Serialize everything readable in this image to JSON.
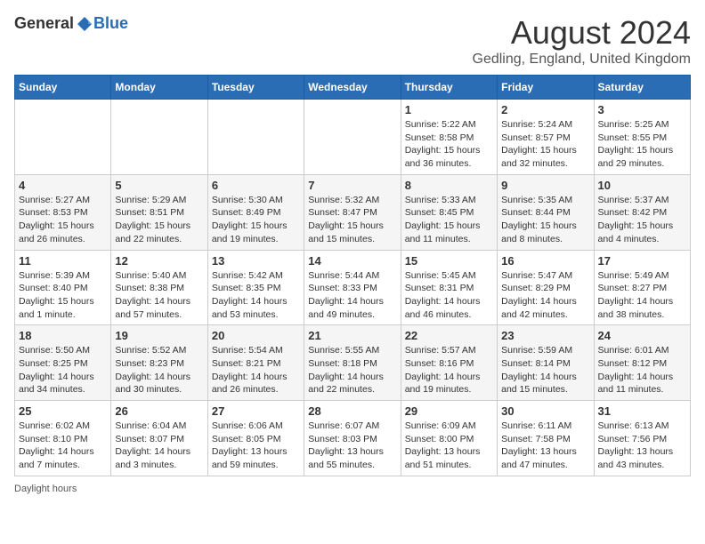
{
  "header": {
    "logo_general": "General",
    "logo_blue": "Blue",
    "main_title": "August 2024",
    "subtitle": "Gedling, England, United Kingdom"
  },
  "calendar": {
    "days_of_week": [
      "Sunday",
      "Monday",
      "Tuesday",
      "Wednesday",
      "Thursday",
      "Friday",
      "Saturday"
    ],
    "weeks": [
      [
        {
          "day": "",
          "info": ""
        },
        {
          "day": "",
          "info": ""
        },
        {
          "day": "",
          "info": ""
        },
        {
          "day": "",
          "info": ""
        },
        {
          "day": "1",
          "info": "Sunrise: 5:22 AM\nSunset: 8:58 PM\nDaylight: 15 hours and 36 minutes."
        },
        {
          "day": "2",
          "info": "Sunrise: 5:24 AM\nSunset: 8:57 PM\nDaylight: 15 hours and 32 minutes."
        },
        {
          "day": "3",
          "info": "Sunrise: 5:25 AM\nSunset: 8:55 PM\nDaylight: 15 hours and 29 minutes."
        }
      ],
      [
        {
          "day": "4",
          "info": "Sunrise: 5:27 AM\nSunset: 8:53 PM\nDaylight: 15 hours and 26 minutes."
        },
        {
          "day": "5",
          "info": "Sunrise: 5:29 AM\nSunset: 8:51 PM\nDaylight: 15 hours and 22 minutes."
        },
        {
          "day": "6",
          "info": "Sunrise: 5:30 AM\nSunset: 8:49 PM\nDaylight: 15 hours and 19 minutes."
        },
        {
          "day": "7",
          "info": "Sunrise: 5:32 AM\nSunset: 8:47 PM\nDaylight: 15 hours and 15 minutes."
        },
        {
          "day": "8",
          "info": "Sunrise: 5:33 AM\nSunset: 8:45 PM\nDaylight: 15 hours and 11 minutes."
        },
        {
          "day": "9",
          "info": "Sunrise: 5:35 AM\nSunset: 8:44 PM\nDaylight: 15 hours and 8 minutes."
        },
        {
          "day": "10",
          "info": "Sunrise: 5:37 AM\nSunset: 8:42 PM\nDaylight: 15 hours and 4 minutes."
        }
      ],
      [
        {
          "day": "11",
          "info": "Sunrise: 5:39 AM\nSunset: 8:40 PM\nDaylight: 15 hours and 1 minute."
        },
        {
          "day": "12",
          "info": "Sunrise: 5:40 AM\nSunset: 8:38 PM\nDaylight: 14 hours and 57 minutes."
        },
        {
          "day": "13",
          "info": "Sunrise: 5:42 AM\nSunset: 8:35 PM\nDaylight: 14 hours and 53 minutes."
        },
        {
          "day": "14",
          "info": "Sunrise: 5:44 AM\nSunset: 8:33 PM\nDaylight: 14 hours and 49 minutes."
        },
        {
          "day": "15",
          "info": "Sunrise: 5:45 AM\nSunset: 8:31 PM\nDaylight: 14 hours and 46 minutes."
        },
        {
          "day": "16",
          "info": "Sunrise: 5:47 AM\nSunset: 8:29 PM\nDaylight: 14 hours and 42 minutes."
        },
        {
          "day": "17",
          "info": "Sunrise: 5:49 AM\nSunset: 8:27 PM\nDaylight: 14 hours and 38 minutes."
        }
      ],
      [
        {
          "day": "18",
          "info": "Sunrise: 5:50 AM\nSunset: 8:25 PM\nDaylight: 14 hours and 34 minutes."
        },
        {
          "day": "19",
          "info": "Sunrise: 5:52 AM\nSunset: 8:23 PM\nDaylight: 14 hours and 30 minutes."
        },
        {
          "day": "20",
          "info": "Sunrise: 5:54 AM\nSunset: 8:21 PM\nDaylight: 14 hours and 26 minutes."
        },
        {
          "day": "21",
          "info": "Sunrise: 5:55 AM\nSunset: 8:18 PM\nDaylight: 14 hours and 22 minutes."
        },
        {
          "day": "22",
          "info": "Sunrise: 5:57 AM\nSunset: 8:16 PM\nDaylight: 14 hours and 19 minutes."
        },
        {
          "day": "23",
          "info": "Sunrise: 5:59 AM\nSunset: 8:14 PM\nDaylight: 14 hours and 15 minutes."
        },
        {
          "day": "24",
          "info": "Sunrise: 6:01 AM\nSunset: 8:12 PM\nDaylight: 14 hours and 11 minutes."
        }
      ],
      [
        {
          "day": "25",
          "info": "Sunrise: 6:02 AM\nSunset: 8:10 PM\nDaylight: 14 hours and 7 minutes."
        },
        {
          "day": "26",
          "info": "Sunrise: 6:04 AM\nSunset: 8:07 PM\nDaylight: 14 hours and 3 minutes."
        },
        {
          "day": "27",
          "info": "Sunrise: 6:06 AM\nSunset: 8:05 PM\nDaylight: 13 hours and 59 minutes."
        },
        {
          "day": "28",
          "info": "Sunrise: 6:07 AM\nSunset: 8:03 PM\nDaylight: 13 hours and 55 minutes."
        },
        {
          "day": "29",
          "info": "Sunrise: 6:09 AM\nSunset: 8:00 PM\nDaylight: 13 hours and 51 minutes."
        },
        {
          "day": "30",
          "info": "Sunrise: 6:11 AM\nSunset: 7:58 PM\nDaylight: 13 hours and 47 minutes."
        },
        {
          "day": "31",
          "info": "Sunrise: 6:13 AM\nSunset: 7:56 PM\nDaylight: 13 hours and 43 minutes."
        }
      ]
    ]
  },
  "footer": {
    "daylight_label": "Daylight hours"
  }
}
